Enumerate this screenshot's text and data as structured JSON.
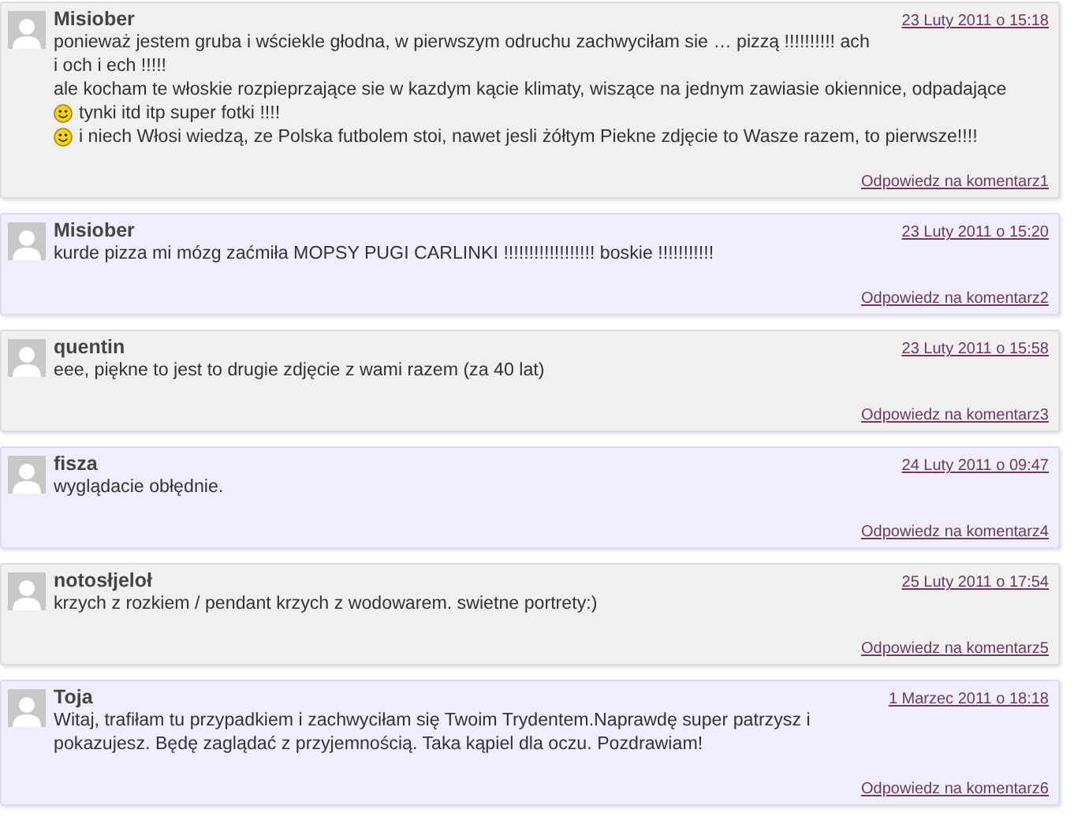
{
  "comments": [
    {
      "author": "Misiober",
      "date": "23 Luty 2011 o 15:18",
      "lines": [
        {
          "text": "ponieważ jestem gruba i wściekle głodna, w pierwszym odruchu zachwyciłam sie … pizzą !!!!!!!!!! ach",
          "smiley": false
        },
        {
          "text": "i och i ech !!!!!",
          "smiley": false
        },
        {
          "text": "ale kocham te włoskie rozpieprzające sie w kazdym kącie klimaty, wiszące na jednym zawiasie okiennice, odpadające",
          "smiley": false
        },
        {
          "text": "tynki itd itp super fotki !!!!",
          "smiley": true
        },
        {
          "text": "i niech Włosi wiedzą, ze Polska futbolem stoi, nawet jesli żółtym Piekne zdjęcie to Wasze razem, to pierwsze!!!!",
          "smiley": true
        }
      ],
      "reply": "Odpowiedz na komentarz1"
    },
    {
      "author": "Misiober",
      "date": "23 Luty 2011 o 15:20",
      "lines": [
        {
          "text": "kurde pizza mi mózg zaćmiła MOPSY PUGI CARLINKI !!!!!!!!!!!!!!!!!! boskie !!!!!!!!!!!",
          "smiley": false
        }
      ],
      "reply": "Odpowiedz na komentarz2"
    },
    {
      "author": "quentin",
      "date": "23 Luty 2011 o 15:58",
      "lines": [
        {
          "text": "eee, piękne to jest to drugie zdjęcie z wami razem (za 40 lat)",
          "smiley": false
        }
      ],
      "reply": "Odpowiedz na komentarz3"
    },
    {
      "author": "fisza",
      "date": "24 Luty 2011 o 09:47",
      "lines": [
        {
          "text": "wyglądacie obłędnie.",
          "smiley": false
        }
      ],
      "reply": "Odpowiedz na komentarz4"
    },
    {
      "author": "notosłjeloł",
      "date": "25 Luty 2011 o 17:54",
      "lines": [
        {
          "text": "krzych z rozkiem / pendant krzych z wodowarem. swietne portrety:)",
          "smiley": false
        }
      ],
      "reply": "Odpowiedz na komentarz5"
    },
    {
      "author": "Toja",
      "date": "1 Marzec 2011 o 18:18",
      "lines": [
        {
          "text": "Witaj, trafiłam tu przypadkiem i zachwyciłam się Twoim Trydentem.Naprawdę super patrzysz i",
          "smiley": false
        },
        {
          "text": "pokazujesz. Będę zaglądać z przyjemnością. Taka kąpiel dla oczu. Pozdrawiam!",
          "smiley": false
        }
      ],
      "reply": "Odpowiedz na komentarz6"
    }
  ]
}
